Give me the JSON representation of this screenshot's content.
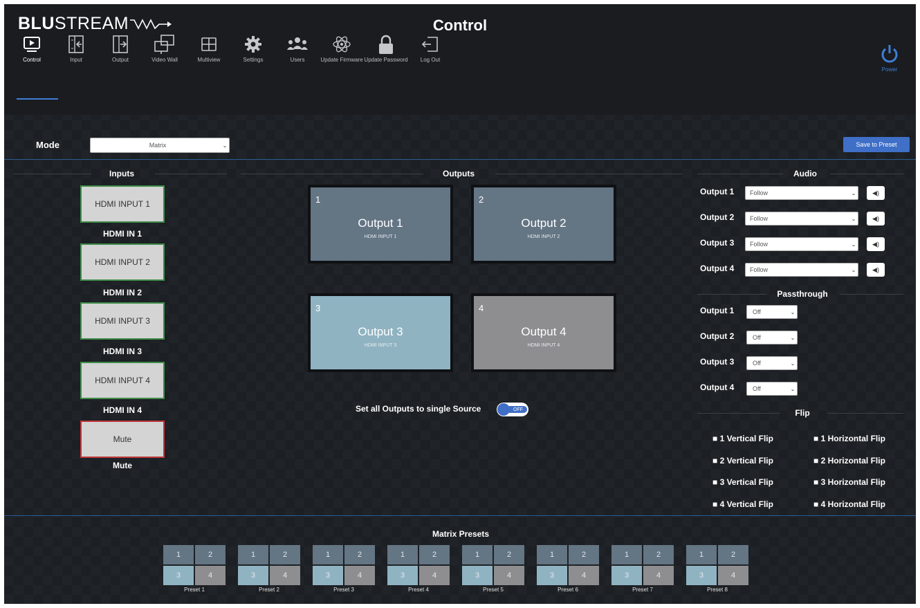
{
  "app": {
    "brand_bold": "BLU",
    "brand_thin": "STREAM",
    "page_title": "Control"
  },
  "nav": [
    {
      "label": "Control",
      "icon": "display-icon",
      "active": true
    },
    {
      "label": "Input",
      "icon": "input-icon"
    },
    {
      "label": "Output",
      "icon": "output-icon"
    },
    {
      "label": "Video Wall",
      "icon": "video-wall-icon"
    },
    {
      "label": "Multiview",
      "icon": "multiview-icon"
    },
    {
      "label": "Settings",
      "icon": "gear-icon"
    },
    {
      "label": "Users",
      "icon": "users-icon"
    },
    {
      "label": "Update Firmware",
      "icon": "atom-icon"
    },
    {
      "label": "Update Password",
      "icon": "lock-icon"
    },
    {
      "label": "Log Out",
      "icon": "logout-icon"
    }
  ],
  "power": {
    "label": "Power",
    "icon": "power-icon"
  },
  "mode": {
    "label": "Mode",
    "value": "Matrix"
  },
  "save_preset": "Save to Preset",
  "sections": {
    "inputs": "Inputs",
    "outputs": "Outputs",
    "audio": "Audio",
    "passthrough": "Passthrough",
    "flip": "Flip",
    "presets": "Matrix Presets"
  },
  "inputs": [
    {
      "button": "HDMI INPUT 1",
      "name": "HDMI IN 1"
    },
    {
      "button": "HDMI INPUT 2",
      "name": "HDMI IN 2"
    },
    {
      "button": "HDMI INPUT 3",
      "name": "HDMI IN 3"
    },
    {
      "button": "HDMI INPUT 4",
      "name": "HDMI IN 4"
    },
    {
      "button": "Mute",
      "name": "Mute"
    }
  ],
  "outputs": [
    {
      "num": "1",
      "name": "Output 1",
      "source": "HDMI INPUT 1"
    },
    {
      "num": "2",
      "name": "Output 2",
      "source": "HDMI INPUT 2"
    },
    {
      "num": "3",
      "name": "Output 3",
      "source": "HDMI INPUT 3"
    },
    {
      "num": "4",
      "name": "Output 4",
      "source": "HDMI INPUT 4"
    }
  ],
  "single_source": {
    "label": "Set all Outputs to single Source",
    "state": "OFF"
  },
  "audio": [
    {
      "label": "Output 1",
      "value": "Follow"
    },
    {
      "label": "Output 2",
      "value": "Follow"
    },
    {
      "label": "Output 3",
      "value": "Follow"
    },
    {
      "label": "Output 4",
      "value": "Follow"
    }
  ],
  "speaker_glyph": "◀)",
  "passthrough": [
    {
      "label": "Output 1",
      "value": "Off"
    },
    {
      "label": "Output 2",
      "value": "Off"
    },
    {
      "label": "Output 3",
      "value": "Off"
    },
    {
      "label": "Output 4",
      "value": "Off"
    }
  ],
  "flip": [
    {
      "vertical": "■ 1 Vertical Flip",
      "horizontal": "■ 1 Horizontal Flip"
    },
    {
      "vertical": "■ 2 Vertical Flip",
      "horizontal": "■ 2 Horizontal Flip"
    },
    {
      "vertical": "■ 3 Vertical Flip",
      "horizontal": "■ 3 Horizontal Flip"
    },
    {
      "vertical": "■ 4 Vertical Flip",
      "horizontal": "■ 4 Horizontal Flip"
    }
  ],
  "presets": [
    {
      "label": "Preset 1",
      "cells": [
        "1",
        "2",
        "3",
        "4"
      ]
    },
    {
      "label": "Preset 2",
      "cells": [
        "1",
        "2",
        "3",
        "4"
      ]
    },
    {
      "label": "Preset 3",
      "cells": [
        "1",
        "2",
        "3",
        "4"
      ]
    },
    {
      "label": "Preset 4",
      "cells": [
        "1",
        "2",
        "3",
        "4"
      ]
    },
    {
      "label": "Preset 5",
      "cells": [
        "1",
        "2",
        "3",
        "4"
      ]
    },
    {
      "label": "Preset 6",
      "cells": [
        "1",
        "2",
        "3",
        "4"
      ]
    },
    {
      "label": "Preset 7",
      "cells": [
        "1",
        "2",
        "3",
        "4"
      ]
    },
    {
      "label": "Preset 8",
      "cells": [
        "1",
        "2",
        "3",
        "4"
      ]
    }
  ],
  "colors": {
    "accent": "#3f6fc7",
    "tile_routed": "#647584",
    "tile_selected": "#90b3c2",
    "tile_muted": "#8e8e91",
    "input_border": "#3e8c4a",
    "mute_border": "#c0373a"
  }
}
